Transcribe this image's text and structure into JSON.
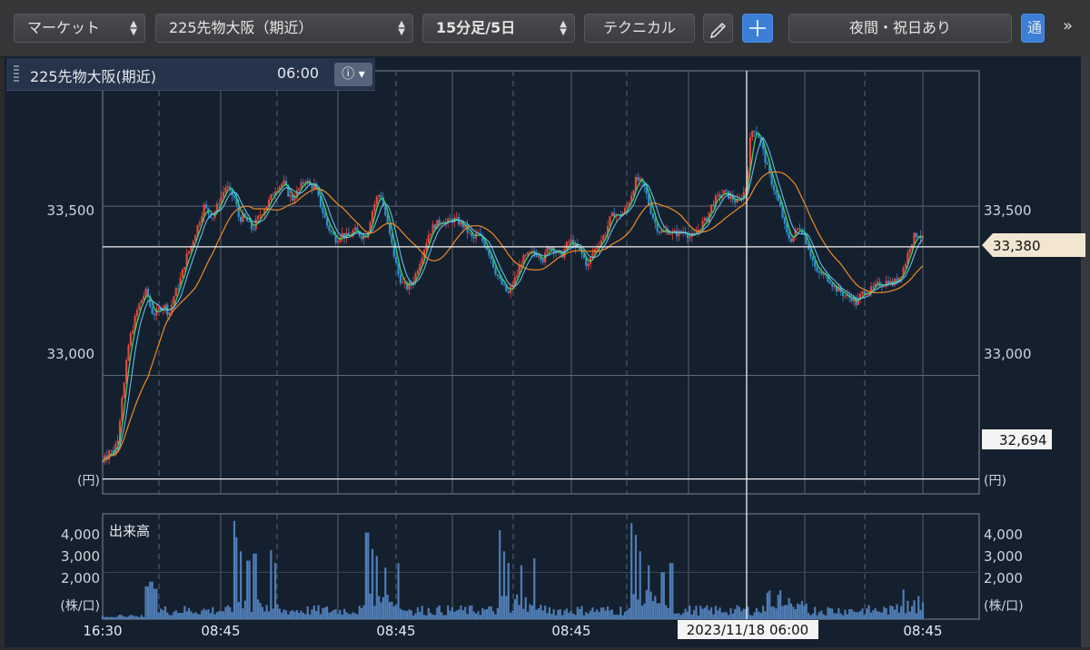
{
  "toolbar": {
    "market": "マーケット",
    "symbol": "225先物大阪（期近）",
    "period": "15分足/5日",
    "technical": "テクニカル",
    "pen_icon": "pencil-icon",
    "crosshair_icon": "crosshair-icon",
    "session": "夜間・祝日あり",
    "tab_cut": "通",
    "more": "»"
  },
  "infobox": {
    "symbol": "225先物大阪(期近)",
    "time": "06:00",
    "info_icon": "info-icon"
  },
  "price_axis": {
    "left_labels": [
      "33,500",
      "33,000"
    ],
    "right_labels": [
      "33,500",
      "33,000"
    ],
    "unit": "(円)",
    "current_price": "33,380",
    "low_line_price": "32,694"
  },
  "volume": {
    "title": "出来高",
    "labels": [
      "4,000",
      "3,000",
      "2,000"
    ],
    "unit": "(株/口)"
  },
  "x_axis": {
    "labels": [
      "16:30",
      "08:45",
      "08:45",
      "08:45",
      "08:45"
    ],
    "crosshair_label": "2023/11/18 06:00"
  },
  "colors": {
    "panel_bg": "#15202f",
    "up": "#e8453c",
    "down": "#2f8fd0",
    "ma_short": "#3fcf6a",
    "ma_mid": "#6ec6ff",
    "ma_long": "#f08a24",
    "volume_bar": "#4f7db5"
  },
  "chart_data": {
    "type": "candlestick",
    "price_ylim": [
      32650,
      33900
    ],
    "volume_ylim": [
      0,
      4500
    ],
    "close_path": [
      [
        0,
        32745
      ],
      [
        0.05,
        32770
      ],
      [
        0.1,
        32760
      ],
      [
        0.15,
        32780
      ],
      [
        0.2,
        32775
      ],
      [
        0.25,
        32770
      ],
      [
        0.3,
        32800
      ],
      [
        0.35,
        32820
      ],
      [
        0.38,
        32840
      ],
      [
        0.4,
        32900
      ],
      [
        0.45,
        32950
      ],
      [
        0.5,
        32980
      ],
      [
        0.55,
        33050
      ],
      [
        0.6,
        33100
      ],
      [
        0.7,
        33150
      ],
      [
        0.8,
        33200
      ],
      [
        0.9,
        33230
      ],
      [
        1,
        33250
      ],
      [
        1.1,
        33190
      ],
      [
        1.2,
        33180
      ],
      [
        1.3,
        33200
      ],
      [
        1.4,
        33210
      ],
      [
        1.5,
        33180
      ],
      [
        1.55,
        33200
      ],
      [
        1.6,
        33230
      ],
      [
        1.7,
        33260
      ],
      [
        1.8,
        33300
      ],
      [
        1.9,
        33350
      ],
      [
        2,
        33380
      ],
      [
        2.1,
        33420
      ],
      [
        2.2,
        33460
      ],
      [
        2.3,
        33500
      ],
      [
        2.4,
        33480
      ],
      [
        2.5,
        33470
      ],
      [
        2.6,
        33500
      ],
      [
        2.7,
        33530
      ],
      [
        2.8,
        33560
      ],
      [
        2.9,
        33540
      ],
      [
        3,
        33520
      ],
      [
        3.1,
        33460
      ],
      [
        3.2,
        33470
      ],
      [
        3.3,
        33450
      ],
      [
        3.4,
        33430
      ],
      [
        3.5,
        33460
      ],
      [
        3.6,
        33480
      ],
      [
        3.7,
        33500
      ],
      [
        3.8,
        33520
      ],
      [
        3.9,
        33550
      ],
      [
        4,
        33560
      ],
      [
        4.1,
        33570
      ],
      [
        4.2,
        33540
      ],
      [
        4.3,
        33520
      ],
      [
        4.4,
        33540
      ],
      [
        4.5,
        33560
      ],
      [
        4.6,
        33580
      ],
      [
        4.7,
        33560
      ],
      [
        4.8,
        33560
      ],
      [
        4.9,
        33520
      ],
      [
        5,
        33480
      ],
      [
        5.1,
        33440
      ],
      [
        5.2,
        33420
      ],
      [
        5.3,
        33400
      ],
      [
        5.4,
        33420
      ],
      [
        5.5,
        33410
      ],
      [
        5.6,
        33410
      ],
      [
        5.7,
        33430
      ],
      [
        5.8,
        33420
      ],
      [
        5.9,
        33410
      ],
      [
        6,
        33420
      ],
      [
        6.1,
        33480
      ],
      [
        6.2,
        33520
      ],
      [
        6.3,
        33540
      ],
      [
        6.4,
        33480
      ],
      [
        6.5,
        33420
      ],
      [
        6.6,
        33360
      ],
      [
        6.7,
        33300
      ],
      [
        6.8,
        33270
      ],
      [
        6.9,
        33260
      ],
      [
        7,
        33270
      ],
      [
        7.1,
        33300
      ],
      [
        7.2,
        33340
      ],
      [
        7.3,
        33380
      ],
      [
        7.4,
        33420
      ],
      [
        7.5,
        33440
      ],
      [
        7.6,
        33450
      ],
      [
        7.7,
        33460
      ],
      [
        7.8,
        33450
      ],
      [
        7.9,
        33460
      ],
      [
        8,
        33460
      ],
      [
        8.1,
        33450
      ],
      [
        8.2,
        33440
      ],
      [
        8.3,
        33420
      ],
      [
        8.4,
        33400
      ],
      [
        8.5,
        33420
      ],
      [
        8.6,
        33400
      ],
      [
        8.7,
        33380
      ],
      [
        8.8,
        33350
      ],
      [
        8.9,
        33310
      ],
      [
        9,
        33280
      ],
      [
        9.1,
        33260
      ],
      [
        9.2,
        33240
      ],
      [
        9.3,
        33270
      ],
      [
        9.4,
        33300
      ],
      [
        9.5,
        33340
      ],
      [
        9.6,
        33350
      ],
      [
        9.7,
        33360
      ],
      [
        9.8,
        33360
      ],
      [
        9.9,
        33360
      ],
      [
        10,
        33340
      ],
      [
        10.1,
        33380
      ],
      [
        10.2,
        33380
      ],
      [
        10.3,
        33360
      ],
      [
        10.4,
        33350
      ],
      [
        10.5,
        33380
      ],
      [
        10.6,
        33400
      ],
      [
        10.7,
        33380
      ],
      [
        10.8,
        33370
      ],
      [
        10.9,
        33350
      ],
      [
        11,
        33320
      ],
      [
        11.1,
        33360
      ],
      [
        11.2,
        33380
      ],
      [
        11.3,
        33400
      ],
      [
        11.4,
        33420
      ],
      [
        11.5,
        33460
      ],
      [
        11.6,
        33480
      ],
      [
        11.7,
        33470
      ],
      [
        11.8,
        33480
      ],
      [
        11.9,
        33500
      ],
      [
        12,
        33540
      ],
      [
        12.1,
        33580
      ],
      [
        12.2,
        33570
      ],
      [
        12.3,
        33550
      ],
      [
        12.4,
        33500
      ],
      [
        12.5,
        33460
      ],
      [
        12.6,
        33430
      ],
      [
        12.7,
        33420
      ],
      [
        12.8,
        33430
      ],
      [
        12.9,
        33420
      ],
      [
        13,
        33420
      ],
      [
        13.1,
        33420
      ],
      [
        13.2,
        33430
      ],
      [
        13.3,
        33410
      ],
      [
        13.4,
        33410
      ],
      [
        13.5,
        33430
      ],
      [
        13.6,
        33450
      ],
      [
        13.7,
        33460
      ],
      [
        13.8,
        33500
      ],
      [
        13.9,
        33520
      ],
      [
        14,
        33530
      ],
      [
        14.1,
        33540
      ],
      [
        14.2,
        33530
      ],
      [
        14.3,
        33520
      ],
      [
        14.4,
        33510
      ],
      [
        14.5,
        33530
      ],
      [
        14.6,
        33560
      ],
      [
        14.7,
        33720
      ],
      [
        14.8,
        33730
      ],
      [
        14.9,
        33700
      ],
      [
        15,
        33650
      ],
      [
        15.1,
        33600
      ],
      [
        15.2,
        33560
      ],
      [
        15.3,
        33520
      ],
      [
        15.4,
        33480
      ],
      [
        15.5,
        33420
      ],
      [
        15.6,
        33400
      ],
      [
        15.7,
        33420
      ],
      [
        15.8,
        33440
      ],
      [
        15.9,
        33420
      ],
      [
        16,
        33380
      ],
      [
        16.1,
        33340
      ],
      [
        16.2,
        33300
      ],
      [
        16.3,
        33300
      ],
      [
        16.4,
        33290
      ],
      [
        16.5,
        33280
      ],
      [
        16.6,
        33260
      ],
      [
        16.7,
        33250
      ],
      [
        16.8,
        33240
      ],
      [
        16.9,
        33230
      ],
      [
        17,
        33230
      ],
      [
        17.1,
        33210
      ],
      [
        17.2,
        33240
      ],
      [
        17.3,
        33250
      ],
      [
        17.4,
        33250
      ],
      [
        17.5,
        33260
      ],
      [
        17.6,
        33270
      ],
      [
        17.7,
        33270
      ],
      [
        17.8,
        33280
      ],
      [
        17.9,
        33270
      ],
      [
        18,
        33280
      ],
      [
        18.1,
        33300
      ],
      [
        18.2,
        33330
      ],
      [
        18.3,
        33380
      ],
      [
        18.4,
        33410
      ],
      [
        18.5,
        33420
      ],
      [
        18.6,
        33400
      ]
    ],
    "volume_spikes": [
      [
        0.95,
        2900
      ],
      [
        1.0,
        1400
      ],
      [
        1.1,
        1600
      ],
      [
        1.2,
        1300
      ],
      [
        3.0,
        4200
      ],
      [
        3.05,
        3500
      ],
      [
        3.15,
        2900
      ],
      [
        3.3,
        2500
      ],
      [
        3.45,
        2800
      ],
      [
        3.8,
        2950
      ],
      [
        3.9,
        2400
      ],
      [
        6.0,
        3700
      ],
      [
        6.1,
        3000
      ],
      [
        6.2,
        2700
      ],
      [
        6.4,
        2200
      ],
      [
        6.7,
        2400
      ],
      [
        9.0,
        3800
      ],
      [
        9.1,
        2900
      ],
      [
        9.2,
        2400
      ],
      [
        9.5,
        2300
      ],
      [
        9.8,
        2600
      ],
      [
        12.0,
        4100
      ],
      [
        12.1,
        3600
      ],
      [
        12.2,
        2900
      ],
      [
        12.4,
        2300
      ],
      [
        12.7,
        2000
      ],
      [
        12.9,
        2400
      ]
    ]
  }
}
